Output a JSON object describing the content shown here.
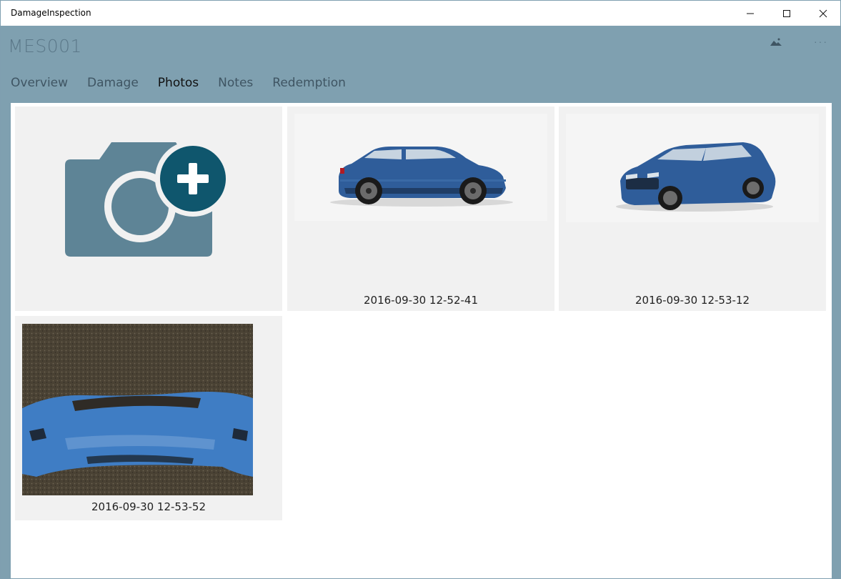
{
  "window": {
    "title": "DamageInspection"
  },
  "header": {
    "record_id": "MES001"
  },
  "toolbar": {
    "photo_icon": "image-icon",
    "more_icon": "more-icon",
    "more_label": "···"
  },
  "tabs": [
    {
      "label": "Overview",
      "active": false
    },
    {
      "label": "Damage",
      "active": false
    },
    {
      "label": "Photos",
      "active": true
    },
    {
      "label": "Notes",
      "active": false
    },
    {
      "label": "Redemption",
      "active": false
    }
  ],
  "photos": {
    "add_icon": "add-photo-icon",
    "items": [
      {
        "label": "2016-09-30 12-52-41",
        "subject": "blue car side view"
      },
      {
        "label": "2016-09-30 12-53-12",
        "subject": "blue car front three-quarter view"
      },
      {
        "label": "2016-09-30 12-53-52",
        "subject": "damaged blue bumper"
      }
    ]
  },
  "colors": {
    "accent": "#7fa0b0",
    "camera": "#5e8496",
    "plus_badge": "#0f566d"
  }
}
